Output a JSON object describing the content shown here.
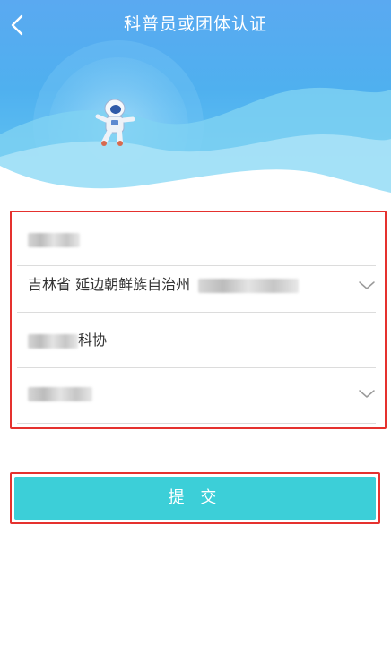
{
  "header": {
    "title": "科普员或团体认证",
    "back_icon": "chevron-left-icon"
  },
  "form": {
    "name_field": {
      "value": "",
      "redacted": true
    },
    "region_field": {
      "value": "吉林省 延边朝鲜族自治州",
      "redacted_suffix": true,
      "icon": "chevron-down-icon"
    },
    "org_field": {
      "suffix": "科协",
      "redacted_prefix": true
    },
    "type_field": {
      "value": "",
      "redacted": true,
      "icon": "chevron-down-icon"
    }
  },
  "submit": {
    "label": "提 交"
  },
  "colors": {
    "header_blue": "#5aa9f1",
    "submit_teal": "#3ccfd8",
    "highlight_red": "#e5312e"
  }
}
